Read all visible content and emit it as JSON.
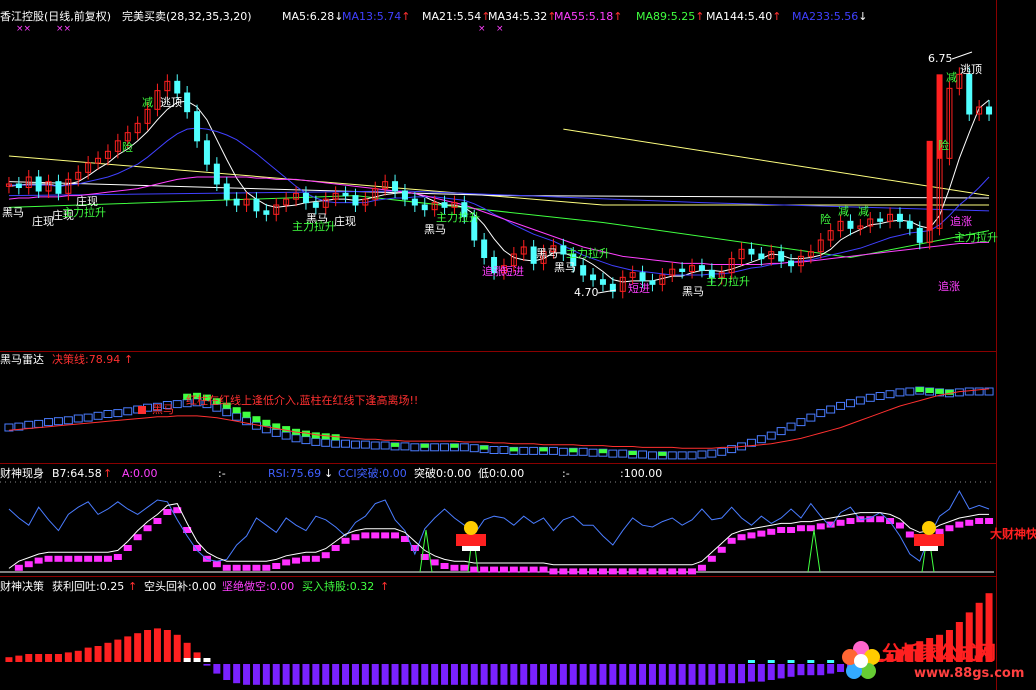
{
  "colors": {
    "up": "#ff2020",
    "down": "#50ffff",
    "ma5": "#ffffff",
    "ma13": "#4040ff",
    "ma21": "#ffffff",
    "ma34": "#ffff60",
    "ma55": "#ff40ff",
    "ma89": "#40ff40",
    "ma144": "#ffffff",
    "ma233": "#4040ff",
    "separator": "#8a0000",
    "green_label": "#40ff40",
    "magenta_label": "#ff40ff"
  },
  "main_panel": {
    "title": "香江控股(日线,前复权)",
    "formula": "完美买卖(28,32,35,3,20)",
    "ma_legend": [
      {
        "label": "MA5:6.28",
        "arrow": "↓",
        "color": "#ffffff"
      },
      {
        "label": "MA13:5.74",
        "arrow": "↑",
        "color": "#4040ff"
      },
      {
        "label": "MA21:5.54",
        "arrow": "↑",
        "color": "#ffffff"
      },
      {
        "label": "MA34:5.32",
        "arrow": "↑",
        "color": "#ffffff"
      },
      {
        "label": "MA55:5.18",
        "arrow": "↑",
        "color": "#ff40ff"
      },
      {
        "label": "MA89:5.25",
        "arrow": "↑",
        "color": "#40ff40"
      },
      {
        "label": "MA144:5.40",
        "arrow": "↑",
        "color": "#ffffff"
      },
      {
        "label": "MA233:5.56",
        "arrow": "↓",
        "color": "#4040ff"
      }
    ],
    "marks": [
      "××",
      "××",
      "×",
      "×"
    ],
    "price_high": "6.75",
    "price_low": "4.70",
    "labels": [
      {
        "text": "减",
        "color": "#40ff40"
      },
      {
        "text": "逃顶",
        "color": "#ffffff"
      },
      {
        "text": "险",
        "color": "#40ff40"
      },
      {
        "text": "黑马",
        "color": "#ffffff"
      },
      {
        "text": "庄现",
        "color": "#ffffff"
      },
      {
        "text": "庄现",
        "color": "#ffffff"
      },
      {
        "text": "主力拉升",
        "color": "#40ff40"
      },
      {
        "text": "庄现",
        "color": "#ffffff"
      },
      {
        "text": "黑马",
        "color": "#ffffff"
      },
      {
        "text": "主力拉升",
        "color": "#40ff40"
      },
      {
        "text": "庄现",
        "color": "#ffffff"
      },
      {
        "text": "黑马",
        "color": "#ffffff"
      },
      {
        "text": "主力拉升",
        "color": "#40ff40"
      },
      {
        "text": "短进",
        "color": "#ff40ff"
      },
      {
        "text": "追涨",
        "color": "#ff40ff"
      },
      {
        "text": "黑马",
        "color": "#ffffff"
      },
      {
        "text": "主力拉升",
        "color": "#40ff40"
      },
      {
        "text": "短进",
        "color": "#ff40ff"
      },
      {
        "text": "黑马",
        "color": "#ffffff"
      },
      {
        "text": "黑马",
        "color": "#ffffff"
      },
      {
        "text": "主力拉升",
        "color": "#40ff40"
      },
      {
        "text": "险",
        "color": "#40ff40"
      },
      {
        "text": "减",
        "color": "#40ff40"
      },
      {
        "text": "减",
        "color": "#40ff40"
      },
      {
        "text": "减",
        "color": "#40ff40"
      },
      {
        "text": "逃顶",
        "color": "#ffffff"
      },
      {
        "text": "险",
        "color": "#40ff40"
      },
      {
        "text": "追涨",
        "color": "#ff40ff"
      },
      {
        "text": "主力拉升",
        "color": "#40ff40"
      },
      {
        "text": "追涨",
        "color": "#ff40ff"
      }
    ]
  },
  "radar_panel": {
    "title": "黑马雷达",
    "line_label": "决策线:78.94",
    "line_arrow": "↑",
    "annotation": "红柱在红线上逢低介入,蓝柱在红线下逢高离场!!",
    "mark_label": "黑马"
  },
  "fortune_panel": {
    "title": "财神现身",
    "b7": "B7:64.58",
    "b7_arrow": "↑",
    "a": "A:0.00",
    "colon": ":-",
    "rsi": "RSI:75.69",
    "rsi_arrow": "↓",
    "cci": "CCI突破:0.00",
    "breakout": "突破0:0.00",
    "low": "低0:0.00",
    "colon2": ":-",
    "hundred": ":100.00",
    "side_label": "大财神快跟进"
  },
  "decision_panel": {
    "title": "财神决策",
    "profit": "获利回吐:0.25",
    "profit_arrow": "↑",
    "short": "空头回补:0.00",
    "firm": "坚绝做空:0.00",
    "buy": "买入持股:0.32",
    "buy_arrow": "↑"
  },
  "logo": {
    "title": "分析家公式网",
    "url": "www.88gs.com"
  },
  "chart_data": [
    {
      "type": "candlestick",
      "title": "香江控股(日线,前复权)",
      "x_count": 100,
      "ylim": [
        4.3,
        7.0
      ],
      "close": [
        5.68,
        5.65,
        5.74,
        5.62,
        5.7,
        5.6,
        5.72,
        5.78,
        5.86,
        5.9,
        5.96,
        6.05,
        6.12,
        6.2,
        6.32,
        6.48,
        6.56,
        6.46,
        6.3,
        6.05,
        5.85,
        5.68,
        5.55,
        5.5,
        5.55,
        5.45,
        5.42,
        5.5,
        5.55,
        5.6,
        5.52,
        5.48,
        5.55,
        5.6,
        5.58,
        5.5,
        5.55,
        5.64,
        5.7,
        5.62,
        5.55,
        5.5,
        5.46,
        5.52,
        5.48,
        5.52,
        5.4,
        5.2,
        5.05,
        4.92,
        4.98,
        5.08,
        5.14,
        5.0,
        5.1,
        5.15,
        5.08,
        4.98,
        4.9,
        4.86,
        4.82,
        4.76,
        4.88,
        4.92,
        4.85,
        4.82,
        4.9,
        4.95,
        4.93,
        4.98,
        4.94,
        4.88,
        4.92,
        5.04,
        5.12,
        5.08,
        5.04,
        5.1,
        5.02,
        4.98,
        5.06,
        5.1,
        5.2,
        5.28,
        5.36,
        5.3,
        5.32,
        5.38,
        5.36,
        5.42,
        5.36,
        5.3,
        5.18,
        5.3,
        5.9,
        6.5,
        6.62,
        6.28,
        6.34,
        6.28
      ],
      "series": [
        {
          "name": "MA5",
          "values": [
            5.66,
            5.67,
            5.68,
            5.68,
            5.68,
            5.66,
            5.68,
            5.7,
            5.75,
            5.81,
            5.86,
            5.93,
            5.98,
            6.05,
            6.13,
            6.23,
            6.32,
            6.38,
            6.39,
            6.34,
            6.23,
            6.06,
            5.89,
            5.73,
            5.61,
            5.55,
            5.5,
            5.48,
            5.49,
            5.5,
            5.52,
            5.53,
            5.54,
            5.55,
            5.55,
            5.54,
            5.55,
            5.57,
            5.59,
            5.6,
            5.61,
            5.6,
            5.57,
            5.53,
            5.5,
            5.5,
            5.48,
            5.42,
            5.33,
            5.21,
            5.11,
            5.05,
            5.03,
            5.02,
            5.04,
            5.09,
            5.09,
            5.06,
            5.04,
            4.99,
            4.93,
            4.86,
            4.84,
            4.85,
            4.85,
            4.85,
            4.87,
            4.89,
            4.89,
            4.92,
            4.94,
            4.94,
            4.93,
            4.95,
            4.98,
            5.01,
            5.04,
            5.08,
            5.07,
            5.04,
            5.04,
            5.05,
            5.07,
            5.12,
            5.2,
            5.25,
            5.29,
            5.33,
            5.34,
            5.36,
            5.37,
            5.36,
            5.32,
            5.3,
            5.41,
            5.64,
            5.9,
            6.12,
            6.33,
            6.4
          ]
        },
        {
          "name": "MA13",
          "values": [
            5.67,
            5.67,
            5.67,
            5.67,
            5.67,
            5.66,
            5.67,
            5.68,
            5.7,
            5.72,
            5.74,
            5.77,
            5.81,
            5.85,
            5.91,
            5.98,
            6.05,
            6.11,
            6.15,
            6.16,
            6.15,
            6.13,
            6.1,
            6.06,
            6.0,
            5.94,
            5.87,
            5.8,
            5.73,
            5.66,
            5.6,
            5.56,
            5.53,
            5.52,
            5.52,
            5.52,
            5.52,
            5.54,
            5.55,
            5.56,
            5.56,
            5.57,
            5.57,
            5.57,
            5.56,
            5.55,
            5.54,
            5.51,
            5.47,
            5.42,
            5.38,
            5.33,
            5.29,
            5.25,
            5.22,
            5.19,
            5.15,
            5.11,
            5.07,
            5.04,
            5.01,
            4.98,
            4.96,
            4.94,
            4.93,
            4.92,
            4.91,
            4.9,
            4.9,
            4.9,
            4.9,
            4.91,
            4.91,
            4.92,
            4.94,
            4.96,
            4.97,
            4.99,
            5.0,
            5.01,
            5.02,
            5.03,
            5.05,
            5.07,
            5.09,
            5.11,
            5.13,
            5.16,
            5.19,
            5.22,
            5.24,
            5.26,
            5.27,
            5.28,
            5.33,
            5.41,
            5.5,
            5.57,
            5.65,
            5.74
          ]
        },
        {
          "name": "MA55",
          "values": [
            5.55,
            5.56,
            5.56,
            5.57,
            5.57,
            5.57,
            5.58,
            5.58,
            5.59,
            5.6,
            5.61,
            5.62,
            5.63,
            5.64,
            5.66,
            5.68,
            5.7,
            5.72,
            5.73,
            5.74,
            5.74,
            5.74,
            5.74,
            5.74,
            5.74,
            5.73,
            5.73,
            5.72,
            5.72,
            5.72,
            5.71,
            5.7,
            5.69,
            5.68,
            5.67,
            5.66,
            5.65,
            5.64,
            5.63,
            5.62,
            5.61,
            5.6,
            5.58,
            5.56,
            5.54,
            5.52,
            5.5,
            5.47,
            5.44,
            5.41,
            5.38,
            5.35,
            5.32,
            5.29,
            5.26,
            5.23,
            5.2,
            5.17,
            5.14,
            5.12,
            5.1,
            5.08,
            5.06,
            5.05,
            5.04,
            5.03,
            5.02,
            5.01,
            5.0,
            5.0,
            5.0,
            4.99,
            4.99,
            4.99,
            4.99,
            4.99,
            4.99,
            5.0,
            5.0,
            5.01,
            5.01,
            5.02,
            5.03,
            5.04,
            5.05,
            5.06,
            5.07,
            5.08,
            5.09,
            5.1,
            5.11,
            5.12,
            5.13,
            5.14,
            5.15,
            5.16,
            5.17,
            5.17,
            5.18,
            5.18
          ]
        }
      ]
    },
    {
      "type": "bar",
      "title": "黑马雷达",
      "x_count": 100,
      "ylim": [
        0,
        100
      ],
      "values": [
        40,
        41,
        43,
        44,
        46,
        47,
        48,
        50,
        51,
        53,
        55,
        56,
        58,
        60,
        62,
        63,
        65,
        66,
        67,
        68,
        66,
        62,
        57,
        52,
        47,
        42,
        38,
        34,
        31,
        28,
        26,
        24,
        23,
        22,
        22,
        21,
        21,
        20,
        20,
        19,
        19,
        18,
        18,
        18,
        18,
        18,
        18,
        17,
        16,
        15,
        15,
        14,
        14,
        14,
        14,
        14,
        13,
        13,
        13,
        12,
        12,
        11,
        11,
        10,
        10,
        9,
        9,
        9,
        9,
        9,
        10,
        11,
        13,
        16,
        19,
        23,
        27,
        31,
        36,
        41,
        46,
        51,
        56,
        60,
        64,
        67,
        70,
        73,
        75,
        77,
        79,
        80,
        81,
        80,
        79,
        78,
        79,
        80,
        80,
        80
      ],
      "decision_line": [
        33,
        34,
        35,
        36,
        37,
        38,
        39,
        40,
        41,
        42,
        43,
        44,
        45,
        46,
        47,
        48,
        48,
        49,
        49,
        49,
        48,
        47,
        45,
        43,
        41,
        39,
        37,
        35,
        33,
        31,
        30,
        28,
        27,
        26,
        25,
        24,
        23,
        23,
        22,
        22,
        21,
        21,
        21,
        21,
        21,
        21,
        20,
        20,
        20,
        19,
        19,
        18,
        18,
        18,
        17,
        17,
        17,
        17,
        16,
        16,
        16,
        15,
        15,
        15,
        14,
        14,
        14,
        14,
        13,
        13,
        13,
        13,
        14,
        14,
        15,
        16,
        17,
        18,
        20,
        22,
        24,
        27,
        30,
        33,
        36,
        40,
        44,
        48,
        52,
        56,
        60,
        63,
        66,
        69,
        72,
        74,
        76,
        77,
        78,
        79
      ]
    },
    {
      "type": "bar",
      "title": "财神现身",
      "x_count": 100,
      "ylim": [
        0,
        100
      ],
      "b7_values": [
        0,
        8,
        12,
        16,
        18,
        18,
        18,
        18,
        18,
        18,
        18,
        20,
        30,
        42,
        52,
        60,
        70,
        72,
        50,
        30,
        18,
        12,
        8,
        8,
        8,
        8,
        8,
        10,
        14,
        16,
        18,
        18,
        22,
        30,
        38,
        42,
        44,
        44,
        44,
        44,
        40,
        30,
        20,
        14,
        10,
        8,
        8,
        6,
        6,
        6,
        6,
        6,
        6,
        6,
        6,
        4,
        4,
        4,
        4,
        4,
        4,
        4,
        4,
        4,
        4,
        4,
        4,
        4,
        4,
        4,
        8,
        18,
        28,
        38,
        42,
        44,
        46,
        48,
        50,
        50,
        52,
        52,
        54,
        56,
        58,
        60,
        62,
        62,
        62,
        60,
        55,
        45,
        40,
        42,
        48,
        52,
        56,
        58,
        60,
        60
      ],
      "rsi_values": [
        70,
        60,
        52,
        72,
        58,
        46,
        64,
        72,
        78,
        64,
        70,
        78,
        70,
        64,
        72,
        80,
        78,
        58,
        40,
        24,
        14,
        12,
        14,
        30,
        40,
        60,
        52,
        44,
        60,
        52,
        46,
        62,
        58,
        50,
        40,
        55,
        62,
        76,
        80,
        58,
        46,
        20,
        48,
        60,
        70,
        60,
        52,
        42,
        58,
        62,
        60,
        52,
        62,
        54,
        60,
        46,
        58,
        62,
        52,
        52,
        40,
        30,
        46,
        60,
        52,
        50,
        56,
        60,
        52,
        58,
        70,
        58,
        60,
        72,
        60,
        52,
        62,
        54,
        60,
        70,
        60,
        76,
        62,
        50,
        66,
        72,
        58,
        60,
        66,
        56,
        40,
        20,
        12,
        40,
        62,
        70,
        90,
        70,
        74,
        70
      ]
    },
    {
      "type": "bar",
      "title": "财神决策",
      "x_count": 100,
      "ylim": [
        -1,
        1
      ],
      "values": [
        0.06,
        0.08,
        0.1,
        0.1,
        0.1,
        0.1,
        0.12,
        0.14,
        0.18,
        0.2,
        0.24,
        0.28,
        0.32,
        0.36,
        0.4,
        0.42,
        0.4,
        0.34,
        0.24,
        0.12,
        -0.02,
        -0.12,
        -0.2,
        -0.24,
        -0.26,
        -0.26,
        -0.26,
        -0.26,
        -0.26,
        -0.26,
        -0.26,
        -0.26,
        -0.26,
        -0.26,
        -0.26,
        -0.26,
        -0.26,
        -0.26,
        -0.26,
        -0.26,
        -0.26,
        -0.26,
        -0.26,
        -0.26,
        -0.26,
        -0.26,
        -0.26,
        -0.26,
        -0.26,
        -0.26,
        -0.26,
        -0.26,
        -0.26,
        -0.26,
        -0.26,
        -0.26,
        -0.26,
        -0.26,
        -0.26,
        -0.26,
        -0.26,
        -0.26,
        -0.26,
        -0.26,
        -0.26,
        -0.26,
        -0.26,
        -0.26,
        -0.26,
        -0.26,
        -0.26,
        -0.26,
        -0.24,
        -0.24,
        -0.24,
        -0.22,
        -0.22,
        -0.2,
        -0.18,
        -0.16,
        -0.14,
        -0.14,
        -0.14,
        -0.12,
        -0.1,
        -0.08,
        -0.06,
        -0.02,
        0.04,
        0.1,
        0.16,
        0.22,
        0.26,
        0.3,
        0.34,
        0.4,
        0.5,
        0.62,
        0.74,
        0.86
      ]
    }
  ]
}
